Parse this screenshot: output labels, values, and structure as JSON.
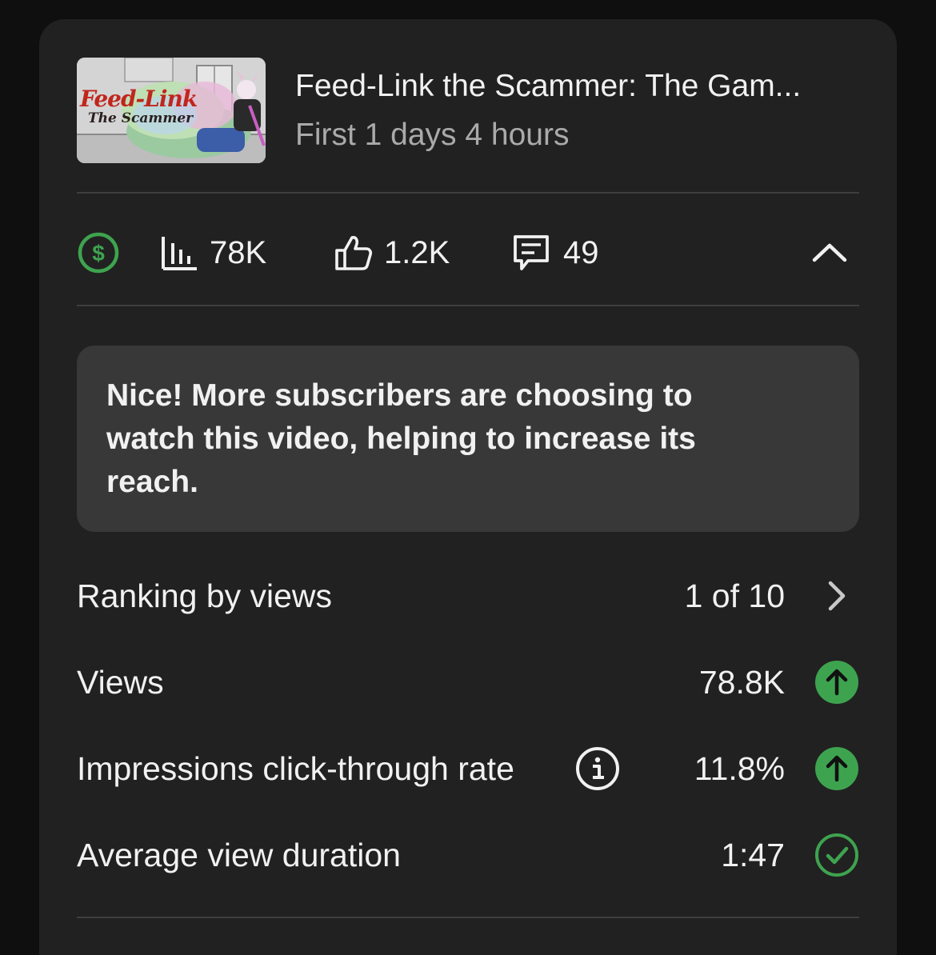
{
  "video": {
    "title": "Feed-Link the Scammer: The Gam...",
    "subtitle": "First 1 days 4 hours",
    "thumbnail": {
      "text_line1": "Feed-Link",
      "text_line2": "The Scammer"
    }
  },
  "stats": {
    "views": "78K",
    "likes": "1.2K",
    "comments": "49"
  },
  "banner": {
    "text": "Nice! More subscribers are choosing to watch this video, helping to increase its reach."
  },
  "metrics": [
    {
      "label": "Ranking by views",
      "value": "1 of 10",
      "indicator": "chevron-right-icon"
    },
    {
      "label": "Views",
      "value": "78.8K",
      "indicator": "arrow-up-icon"
    },
    {
      "label": "Impressions click-through rate",
      "value": "11.8%",
      "indicator": "arrow-up-icon"
    },
    {
      "label": "Average view duration",
      "value": "1:47",
      "indicator": "check-circle-icon"
    }
  ],
  "colors": {
    "background": "#0f0f0f",
    "card": "#212121",
    "banner": "#383838",
    "accent_green": "#3ea34f",
    "secondary_text": "#aaaaaa"
  }
}
